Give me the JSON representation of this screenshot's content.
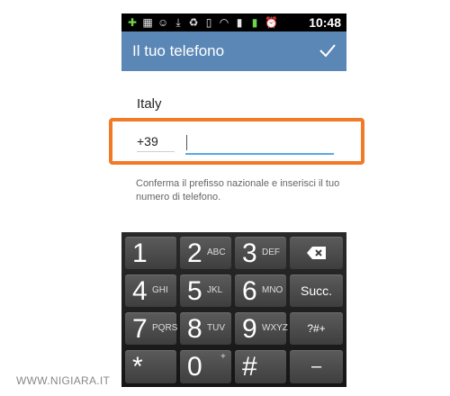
{
  "status_bar": {
    "time": "10:48",
    "icons": [
      "usb-icon",
      "bbm-icon",
      "person-icon",
      "download-icon",
      "recycle-icon",
      "vibrate-icon",
      "wifi-icon",
      "signal-icon",
      "battery-icon",
      "alarm-icon"
    ]
  },
  "header": {
    "title": "Il tuo telefono",
    "confirm_icon": "check-icon"
  },
  "form": {
    "country": "Italy",
    "prefix": "+39",
    "phone_value": "",
    "help_text": "Conferma il prefisso nazionale e inserisci il tuo numero di telefono."
  },
  "keypad": {
    "keys": [
      {
        "digit": "1",
        "letters": ""
      },
      {
        "digit": "2",
        "letters": "ABC"
      },
      {
        "digit": "3",
        "letters": "DEF"
      },
      {
        "digit": "4",
        "letters": "GHI"
      },
      {
        "digit": "5",
        "letters": "JKL"
      },
      {
        "digit": "6",
        "letters": "MNO"
      },
      {
        "digit": "7",
        "letters": "PQRS"
      },
      {
        "digit": "8",
        "letters": "TUV"
      },
      {
        "digit": "9",
        "letters": "WXYZ"
      },
      {
        "digit": "*",
        "letters": ""
      },
      {
        "digit": "0",
        "letters": "+"
      },
      {
        "digit": "#",
        "letters": ""
      }
    ],
    "next_label": "Succ.",
    "symbols_label": "?#+",
    "minus_label": "–"
  },
  "watermark": "WWW.NIGIARA.IT",
  "colors": {
    "header_bg": "#5b87b6",
    "highlight": "#f27a26",
    "input_underline": "#5aa9e2"
  }
}
